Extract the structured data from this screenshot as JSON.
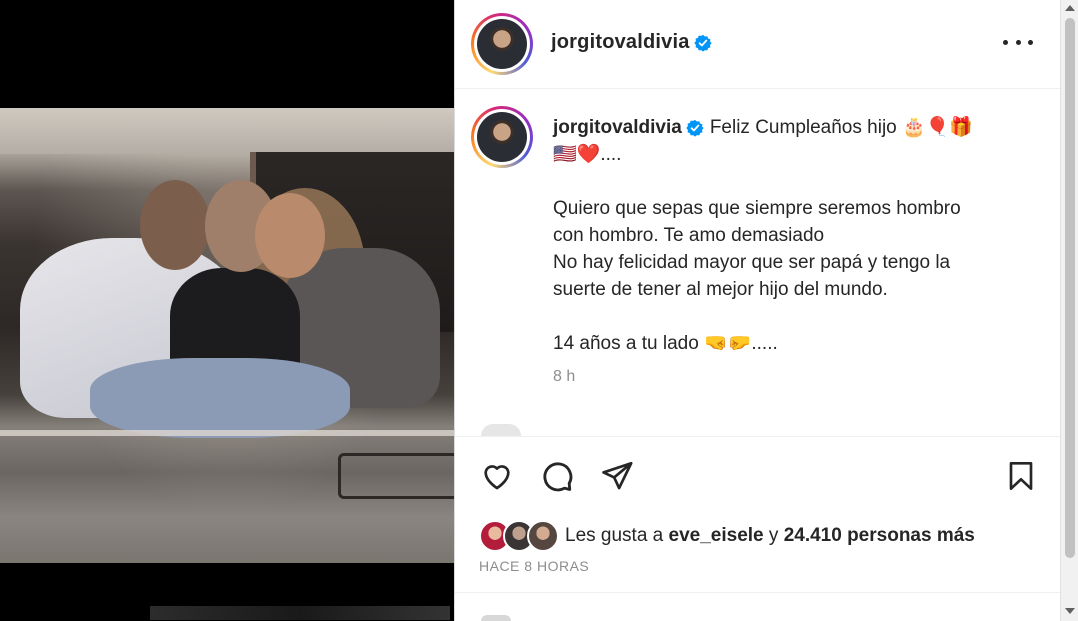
{
  "post": {
    "username": "jorgitovaldivia",
    "caption_line1": "Feliz Cumpleaños hijo 🎂🎈🎁",
    "caption_line2": "🇺🇸❤️....",
    "caption_p2_l1": "Quiero que sepas que siempre seremos hombro",
    "caption_p2_l2": "con hombro. Te amo demasiado",
    "caption_p2_l3": "No hay felicidad mayor que ser papá y tengo la",
    "caption_p2_l4": "suerte de tener al mejor hijo del mundo.",
    "caption_p3": "14 años a tu lado 🤜🤛.....",
    "time_ago": "8 h"
  },
  "likes": {
    "prefix": "Les gusta a ",
    "user": "eve_eisele",
    "middle": " y ",
    "count": "24.410 personas más"
  },
  "posted": "HACE 8 HORAS",
  "icons": {
    "verified": "verified-badge-icon",
    "more": "more-options-icon",
    "like": "heart-icon",
    "comment": "comment-icon",
    "share": "send-icon",
    "save": "bookmark-icon"
  },
  "colors": {
    "verified": "#0095f6",
    "text": "#262626",
    "secondary": "#8e8e8e"
  }
}
